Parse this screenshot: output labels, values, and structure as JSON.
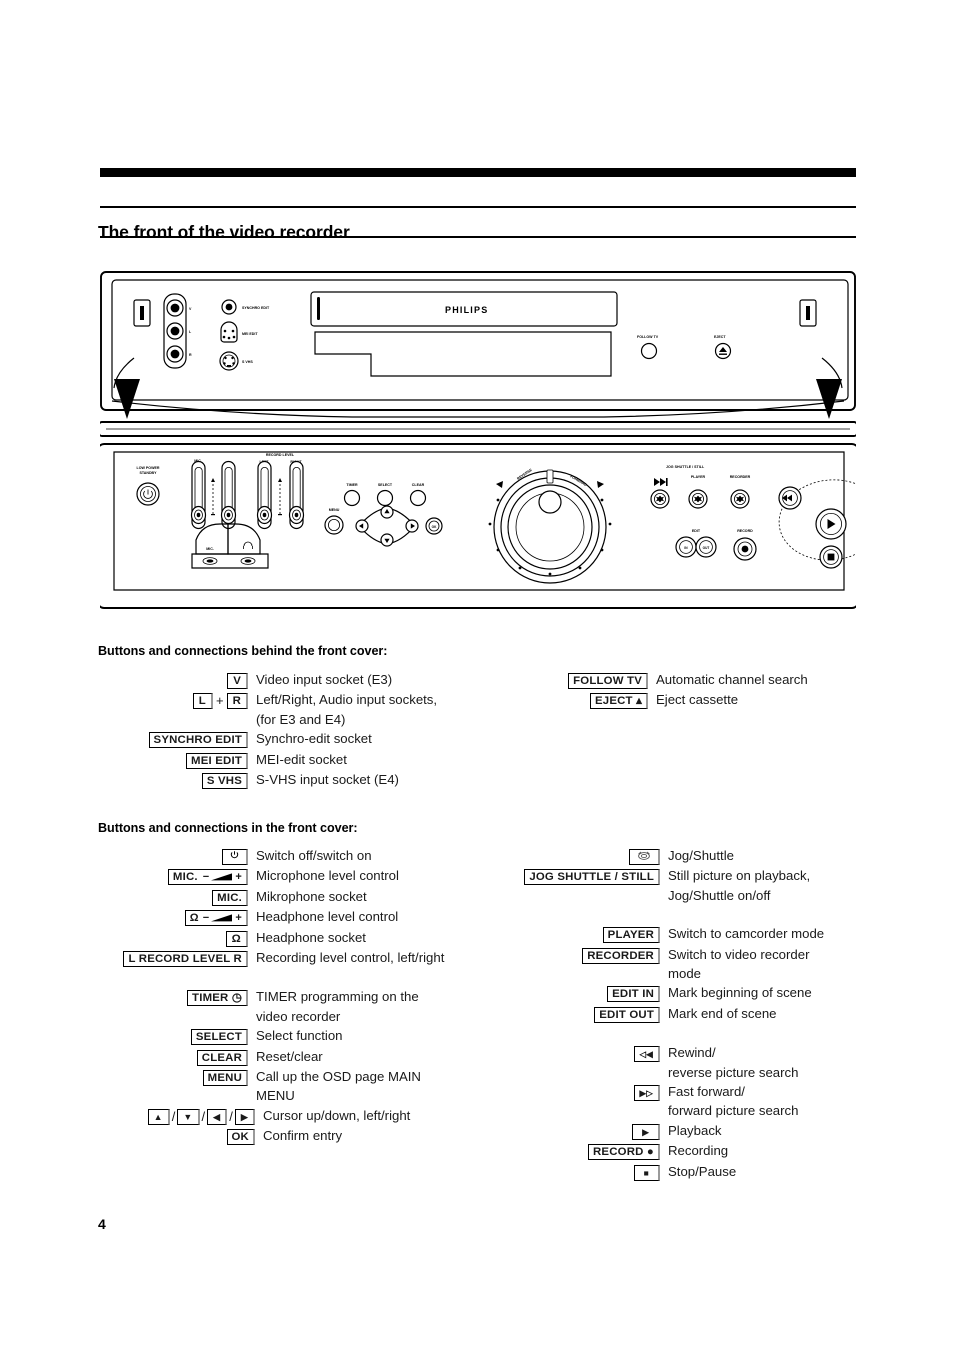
{
  "page": {
    "title": "The front of the video recorder",
    "number": "4"
  },
  "diagram": {
    "brand": "PHILIPS",
    "top_panel": {
      "socket_labels": [
        "V",
        "L",
        "R"
      ],
      "connector_labels": [
        "SYNCHRO EDIT",
        "MEI EDIT",
        "S VHS"
      ],
      "buttons": [
        "FOLLOW TV",
        "EJECT"
      ]
    },
    "bottom_panel": {
      "power_label": "LOW POWER\nSTANDBY",
      "slider_labels": [
        "MIC.",
        "Ω",
        "RECORD LEVEL",
        "LEFT",
        "RIGHT"
      ],
      "small_buttons": [
        "TIMER",
        "SELECT",
        "CLEAR"
      ],
      "menu_label": "MENU",
      "ok_label": "OK",
      "jog_header": "JOG SHUTTLE / STILL",
      "mode_buttons": [
        "PLAYER",
        "RECORDER"
      ],
      "edit_label": "EDIT",
      "edit_buttons": [
        "IN",
        "OUT"
      ],
      "record_label": "RECORD",
      "dial_labels": [
        "REVERSE",
        "FORWARD"
      ],
      "cover_labels": [
        "MIC.",
        "Ω"
      ]
    }
  },
  "sections": {
    "behind": {
      "heading": "Buttons and connections behind the front cover:",
      "left_rows": [
        {
          "caps": [
            "V"
          ],
          "desc": "Video input socket (E3)"
        },
        {
          "caps": [
            "L",
            "R"
          ],
          "sep": "+",
          "desc": "Left/Right, Audio input sockets,\n(for E3 and E4)"
        },
        {
          "caps": [
            "SYNCHRO EDIT"
          ],
          "desc": "Synchro-edit socket"
        },
        {
          "caps": [
            "MEI EDIT"
          ],
          "desc": "MEI-edit socket"
        },
        {
          "caps": [
            "S VHS"
          ],
          "desc": "S-VHS input socket (E4)"
        }
      ],
      "right_rows": [
        {
          "caps": [
            "FOLLOW TV"
          ],
          "desc": "Automatic channel search"
        },
        {
          "caps": [
            "EJECT ▴"
          ],
          "desc": "Eject cassette"
        }
      ]
    },
    "in": {
      "heading": "Buttons and connections in the front cover:",
      "left_rows": [
        {
          "key_type": "power",
          "desc": "Switch off/switch on"
        },
        {
          "key_type": "mic-level",
          "label_pre": "MIC.",
          "minus": "−",
          "plus": "+",
          "desc": "Microphone level control"
        },
        {
          "caps": [
            "MIC."
          ],
          "desc": "Mikrophone socket"
        },
        {
          "key_type": "phones-level",
          "label_pre": "Ω",
          "minus": "−",
          "plus": "+",
          "desc": "Headphone level control"
        },
        {
          "caps": [
            "Ω"
          ],
          "desc": "Headphone socket"
        },
        {
          "caps": [
            "L  RECORD LEVEL  R"
          ],
          "desc": "Recording level control, left/right"
        },
        {
          "caps": [
            "TIMER ◷"
          ],
          "spacer": true,
          "desc": "TIMER programming on the\nvideo recorder"
        },
        {
          "caps": [
            "SELECT"
          ],
          "desc": "Select function"
        },
        {
          "caps": [
            "CLEAR"
          ],
          "desc": "Reset/clear"
        },
        {
          "caps": [
            "MENU"
          ],
          "desc": "Call up the OSD page MAIN\nMENU"
        },
        {
          "caps": [
            "▲",
            "▼",
            "◀",
            "▶"
          ],
          "sep": "/",
          "desc": "Cursor up/down, left/right"
        },
        {
          "caps": [
            "OK"
          ],
          "desc": "Confirm entry"
        }
      ],
      "right_rows": [
        {
          "key_type": "jog-icon",
          "desc": "Jog/Shuttle"
        },
        {
          "caps": [
            "JOG SHUTTLE / STILL"
          ],
          "desc": "Still picture on playback,\nJog/Shuttle on/off"
        },
        {
          "caps": [
            "PLAYER"
          ],
          "spacer": true,
          "desc": "Switch to camcorder mode"
        },
        {
          "caps": [
            "RECORDER"
          ],
          "desc": "Switch to video recorder\nmode"
        },
        {
          "caps": [
            "EDIT IN"
          ],
          "desc": "Mark beginning of scene"
        },
        {
          "caps": [
            "EDIT OUT"
          ],
          "desc": "Mark end of scene"
        },
        {
          "caps": [
            "◁◀"
          ],
          "spacer": true,
          "desc": "Rewind/\nreverse picture search"
        },
        {
          "caps": [
            "▶▷"
          ],
          "desc": "Fast forward/\nforward picture search"
        },
        {
          "caps": [
            "▶"
          ],
          "desc": "Playback"
        },
        {
          "caps": [
            "RECORD ●"
          ],
          "desc": "Recording"
        },
        {
          "caps": [
            "■"
          ],
          "desc": "Stop/Pause"
        }
      ]
    }
  }
}
